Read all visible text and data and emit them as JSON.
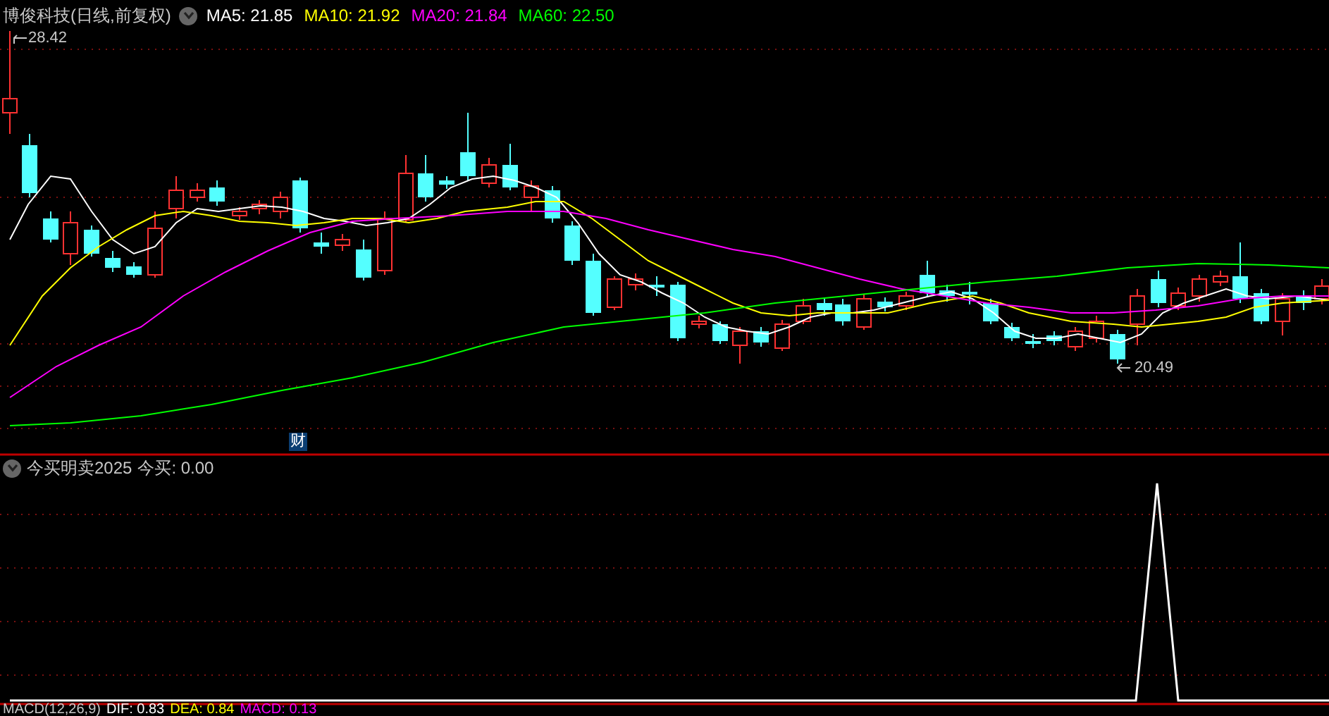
{
  "header": {
    "title": "博俊科技(日线,前复权)",
    "ma_values": [
      {
        "label": "MA5: 21.85",
        "color": "#ffffff"
      },
      {
        "label": "MA10: 21.92",
        "color": "#ffff00"
      },
      {
        "label": "MA20: 21.84",
        "color": "#ff00ff"
      },
      {
        "label": "MA60: 22.50",
        "color": "#00ff00"
      }
    ]
  },
  "price_chart": {
    "high_label": "28.42",
    "low_label": "20.49",
    "event_badge": "财"
  },
  "indicator_panel": {
    "title": "今买明卖2025",
    "reading": "今买: 0.00"
  },
  "macd_panel": {
    "title": "MACD(12,26,9)",
    "values": [
      {
        "label": "DIF: 0.83",
        "color": "#ffffff"
      },
      {
        "label": "DEA: 0.84",
        "color": "#ffff00"
      },
      {
        "label": "MACD: 0.13",
        "color": "#ff00ff"
      }
    ]
  }
}
